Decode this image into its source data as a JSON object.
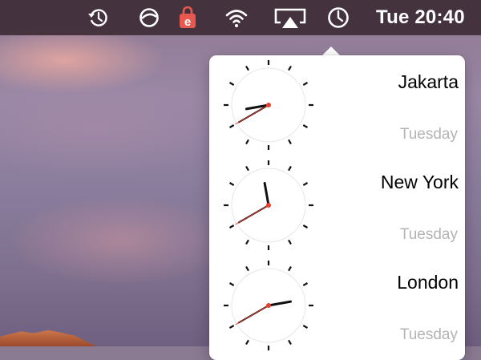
{
  "menubar": {
    "time_label": "Tue 20:40",
    "icons": [
      "time-machine-icon",
      "sync-icon",
      "e-app-icon",
      "wifi-icon",
      "airplay-icon",
      "clock-icon"
    ]
  },
  "world_clock": {
    "cities": [
      {
        "name": "Jakarta",
        "day": "Tuesday",
        "time": "20:40"
      },
      {
        "name": "New York",
        "day": "Tuesday",
        "time": "11:40"
      },
      {
        "name": "London",
        "day": "Tuesday",
        "time": "14:40"
      }
    ]
  },
  "colors": {
    "menubar": "#3e2c36",
    "popover": "#ffffff",
    "second_hand": "#e8402f",
    "day_text": "#b4b4b4",
    "app_icon": "#e8584e"
  }
}
